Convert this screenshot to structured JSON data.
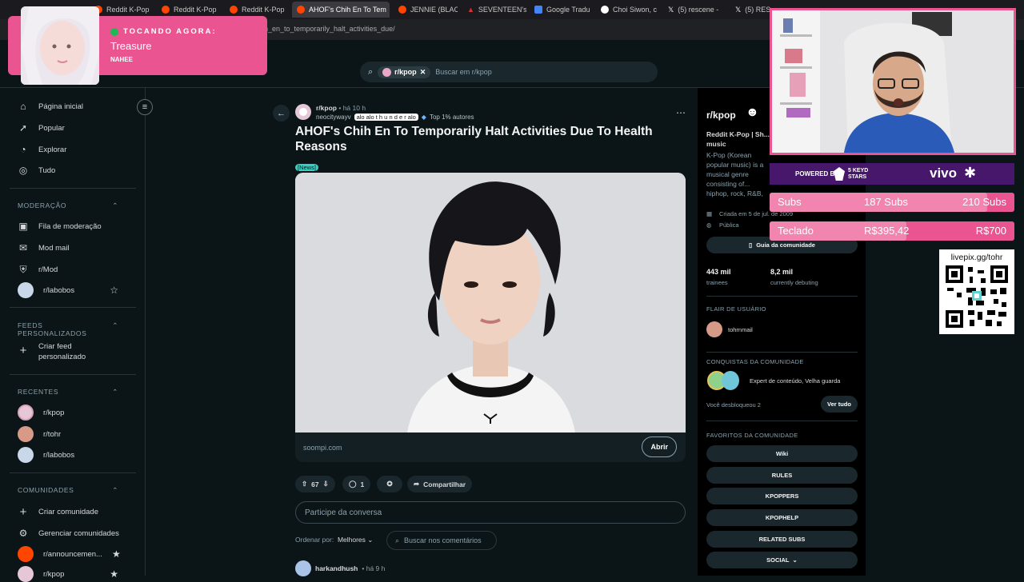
{
  "browser": {
    "tabs": [
      "Reddit K-Pop",
      "Reddit K-Pop",
      "Reddit K-Pop",
      "AHOF's Chih En To Tem",
      "JENNIE (BLAC",
      "SEVENTEEN's",
      "Google Tradu",
      "Choi Siwon, c",
      "(5) rescene -",
      "(5) RES"
    ],
    "url": "n_en_to_temporarily_halt_activities_due/"
  },
  "search": {
    "chip": "r/kpop",
    "placeholder": "Buscar em r/kpop"
  },
  "sidebar": {
    "main": [
      {
        "label": "Página inicial",
        "icon": "home-icon"
      },
      {
        "label": "Popular",
        "icon": "popular-icon"
      },
      {
        "label": "Explorar",
        "icon": "explore-icon"
      },
      {
        "label": "Tudo",
        "icon": "all-icon"
      }
    ],
    "moderation_title": "MODERAÇÃO",
    "moderation": [
      {
        "label": "Fila de moderação"
      },
      {
        "label": "Mod mail"
      },
      {
        "label": "r/Mod"
      },
      {
        "label": "r/labobos"
      }
    ],
    "feeds_title": "FEEDS PERSONALIZADOS",
    "feeds_create": "Criar feed personalizado",
    "recent_title": "RECENTES",
    "recent": [
      "r/kpop",
      "r/tohr",
      "r/labobos"
    ],
    "communities_title": "COMUNIDADES",
    "communities": [
      "Criar comunidade",
      "Gerenciar comunidades",
      "r/announcemen...",
      "r/kpop"
    ]
  },
  "post": {
    "subreddit": "r/kpop",
    "time": "• há 10 h",
    "author": "neocitywayv",
    "author_flair": "alo alo t h u n d e r alo",
    "top_badge": "Top 1% autores",
    "title": "AHOF's Chih En To Temporarily Halt Activities Due To Health Reasons",
    "flair": "[News]",
    "domain": "soompi.com",
    "open_label": "Abrir",
    "votes": "67",
    "comments": "1",
    "share_label": "Compartilhar",
    "comment_placeholder": "Participe da conversa",
    "sort_label": "Ordenar por:",
    "sort_value": "Melhores",
    "comment_search": "Buscar nos comentários",
    "first_comment_user": "harkandhush",
    "first_comment_time": "• há 9 h"
  },
  "right": {
    "title": "r/kpop",
    "name": "Reddit K-Pop | Sh... music",
    "desc": "K-Pop (Korean popular music) is a musical genre consisting of... hiphop, rock, R&B,",
    "created": "Criada em 5 de jul. de 2009",
    "public": "Pública",
    "guide": "Guia da comunidade",
    "stat1_value": "443 mil",
    "stat1_label": "trainees",
    "stat2_value": "8,2 mil",
    "stat2_label": "currently debuting",
    "user_flair_title": "FLAIR DE USUÁRIO",
    "user_flair": "tohrnmail",
    "achievements_title": "CONQUISTAS DA COMUNIDADE",
    "achievements": "Expert de conteúdo, Velha guarda",
    "unlocked": "Você desbloqueou 2",
    "see_all": "Ver tudo",
    "favorites_title": "FAVORITOS DA COMUNIDADE",
    "favorites": [
      "Wiki",
      "RULES",
      "KPOPPERS",
      "KPOPHELP",
      "RELATED SUBS",
      "SOCIAL"
    ]
  },
  "overlay": {
    "now_playing_label": "TOCANDO AGORA:",
    "song": "Treasure",
    "artist": "NAHEE",
    "sponsor_powered": "POWERED BY",
    "sponsor_brand1": "5 KEYD STARS",
    "sponsor_brand2": "vivo",
    "goal1_label": "Subs",
    "goal1_current": "187 Subs",
    "goal1_target": "210 Subs",
    "goal1_progress": 0.89,
    "goal2_label": "Teclado",
    "goal2_current": "R$395,42",
    "goal2_target": "R$700",
    "goal2_progress": 0.56,
    "qr_label": "livepix.gg/tohr"
  }
}
